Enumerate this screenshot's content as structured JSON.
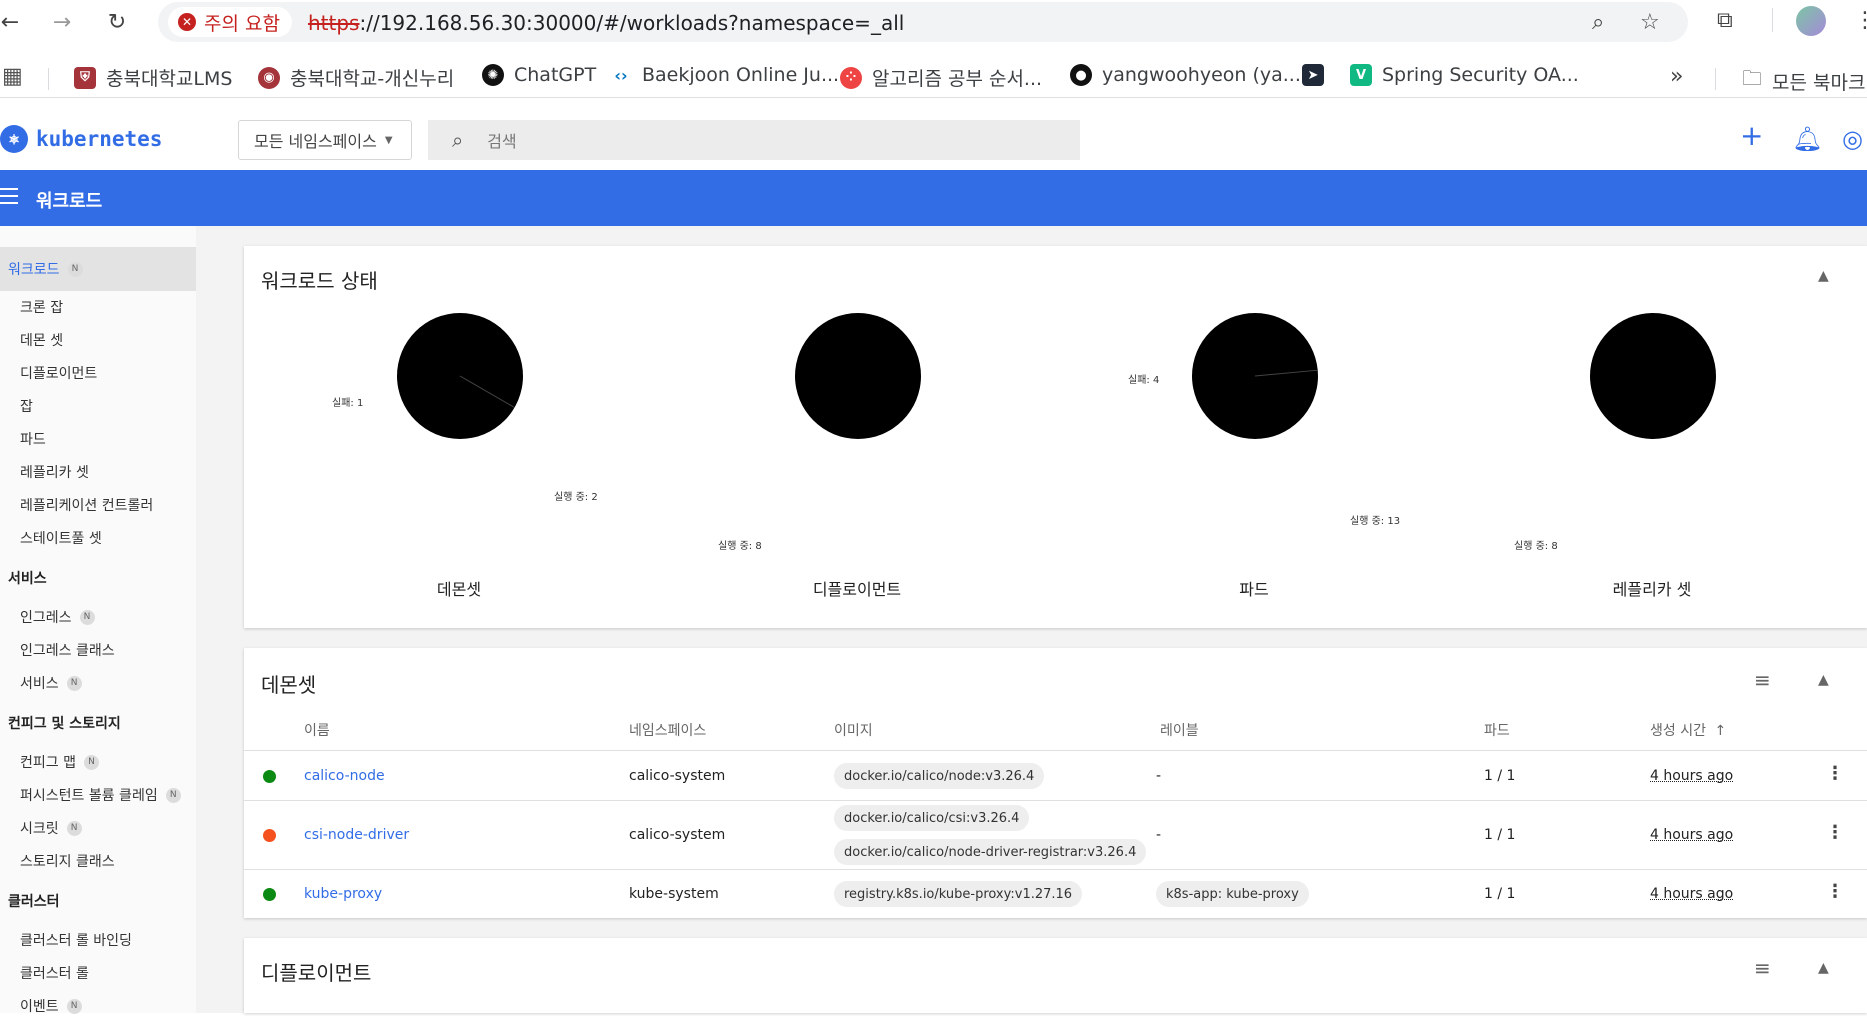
{
  "browser": {
    "warning_label": "주의 요함",
    "url_scheme": "https",
    "url_rest": "://192.168.56.30:30000/#/workloads?namespace=_all",
    "bookmarks": [
      {
        "label": "충북대학교LMS",
        "color": "#a4343a"
      },
      {
        "label": "충북대학교-개신누리",
        "color": "#a4343a"
      },
      {
        "label": "ChatGPT",
        "color": "#111111"
      },
      {
        "label": "Baekjoon Online Ju...",
        "color": "#0076c0"
      },
      {
        "label": "알고리즘 공부 순서...",
        "color": "#ef4444"
      },
      {
        "label": "yangwoohyeon (ya...",
        "color": "#111111"
      },
      {
        "label": "",
        "color": "#1f2937"
      },
      {
        "label": "Spring Security OA...",
        "color": "#10b981"
      },
      {
        "label": "모든 북마크",
        "color": "#555555"
      }
    ]
  },
  "app": {
    "logo_text": "kubernetes",
    "namespace_select": "모든 네임스페이스",
    "search_placeholder": "검색",
    "page_title": "워크로드"
  },
  "sidebar": {
    "active": "워크로드",
    "workloads": [
      "크론 잡",
      "데몬 셋",
      "디플로이먼트",
      "잡",
      "파드",
      "레플리카 셋",
      "레플리케이션 컨트롤러",
      "스테이트풀 셋"
    ],
    "services_head": "서비스",
    "services": [
      "인그레스",
      "인그레스 클래스",
      "서비스"
    ],
    "config_head": "컨피그 및 스토리지",
    "config": [
      "컨피그 맵",
      "퍼시스턴트 볼륨 클레임",
      "시크릿",
      "스토리지 클래스"
    ],
    "cluster_head": "클러스터",
    "cluster": [
      "클러스터 롤 바인딩",
      "클러스터 롤",
      "이벤트"
    ],
    "badge": "N"
  },
  "status_card": {
    "title": "워크로드 상태",
    "charts": [
      {
        "name": "데몬셋",
        "failed_label": "실패: 1",
        "running_label": "실행 중: 2",
        "failed": 1,
        "running": 2
      },
      {
        "name": "디플로이먼트",
        "failed_label": "",
        "running_label": "실행 중: 8",
        "failed": 0,
        "running": 8
      },
      {
        "name": "파드",
        "failed_label": "실패: 4",
        "running_label": "실행 중: 13",
        "failed": 4,
        "running": 13
      },
      {
        "name": "레플리카 셋",
        "failed_label": "",
        "running_label": "실행 중: 8",
        "failed": 0,
        "running": 8
      }
    ]
  },
  "daemonsets": {
    "title": "데몬셋",
    "columns": [
      "이름",
      "네임스페이스",
      "이미지",
      "레이블",
      "파드",
      "생성 시간"
    ],
    "rows": [
      {
        "status": "#0b8a13",
        "name": "calico-node",
        "namespace": "calico-system",
        "images": [
          "docker.io/calico/node:v3.26.4"
        ],
        "labels": "-",
        "pods": "1 / 1",
        "age": "4 hours ago"
      },
      {
        "status": "#f4511e",
        "name": "csi-node-driver",
        "namespace": "calico-system",
        "images": [
          "docker.io/calico/csi:v3.26.4",
          "docker.io/calico/node-driver-registrar:v3.26.4"
        ],
        "labels": "-",
        "pods": "1 / 1",
        "age": "4 hours ago"
      },
      {
        "status": "#0b8a13",
        "name": "kube-proxy",
        "namespace": "kube-system",
        "images": [
          "registry.k8s.io/kube-proxy:v1.27.16"
        ],
        "labels": "k8s-app: kube-proxy",
        "pods": "1 / 1",
        "age": "4 hours ago"
      }
    ]
  },
  "deployments": {
    "title": "디플로이먼트"
  }
}
